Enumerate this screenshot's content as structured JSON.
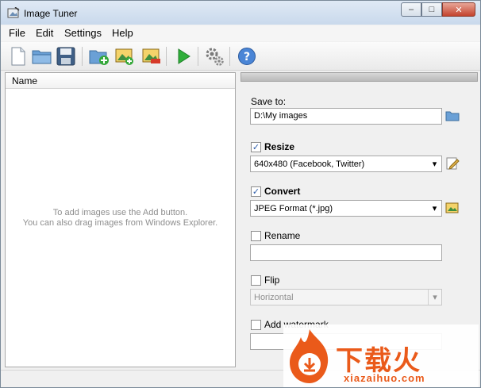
{
  "window": {
    "title": "Image Tuner"
  },
  "menu": [
    "File",
    "Edit",
    "Settings",
    "Help"
  ],
  "toolbar": {
    "icons": [
      "new-file-icon",
      "open-folder-icon",
      "save-icon",
      "add-folder-icon",
      "add-image-icon",
      "remove-image-icon",
      "start-icon",
      "settings-icon",
      "help-icon"
    ]
  },
  "list": {
    "column_name": "Name",
    "empty_line1": "To add images use the Add button.",
    "empty_line2": "You can also drag images from Windows Explorer."
  },
  "settings": {
    "save_to_label": "Save to:",
    "save_to_value": "D:\\My images",
    "resize_label": "Resize",
    "resize_checked": true,
    "resize_value": "640x480 (Facebook, Twitter)",
    "convert_label": "Convert",
    "convert_checked": true,
    "convert_value": "JPEG Format (*.jpg)",
    "rename_label": "Rename",
    "rename_checked": false,
    "rename_value": "",
    "flip_label": "Flip",
    "flip_checked": false,
    "flip_value": "Horizontal",
    "watermark_label": "Add watermark",
    "watermark_checked": false
  },
  "watermark_logo": {
    "text": "下载火",
    "url": "xiazaihuo.com"
  },
  "colors": {
    "accent": "#3a76c4",
    "watermark": "#ea5a1a",
    "start": "#2fae3a"
  }
}
